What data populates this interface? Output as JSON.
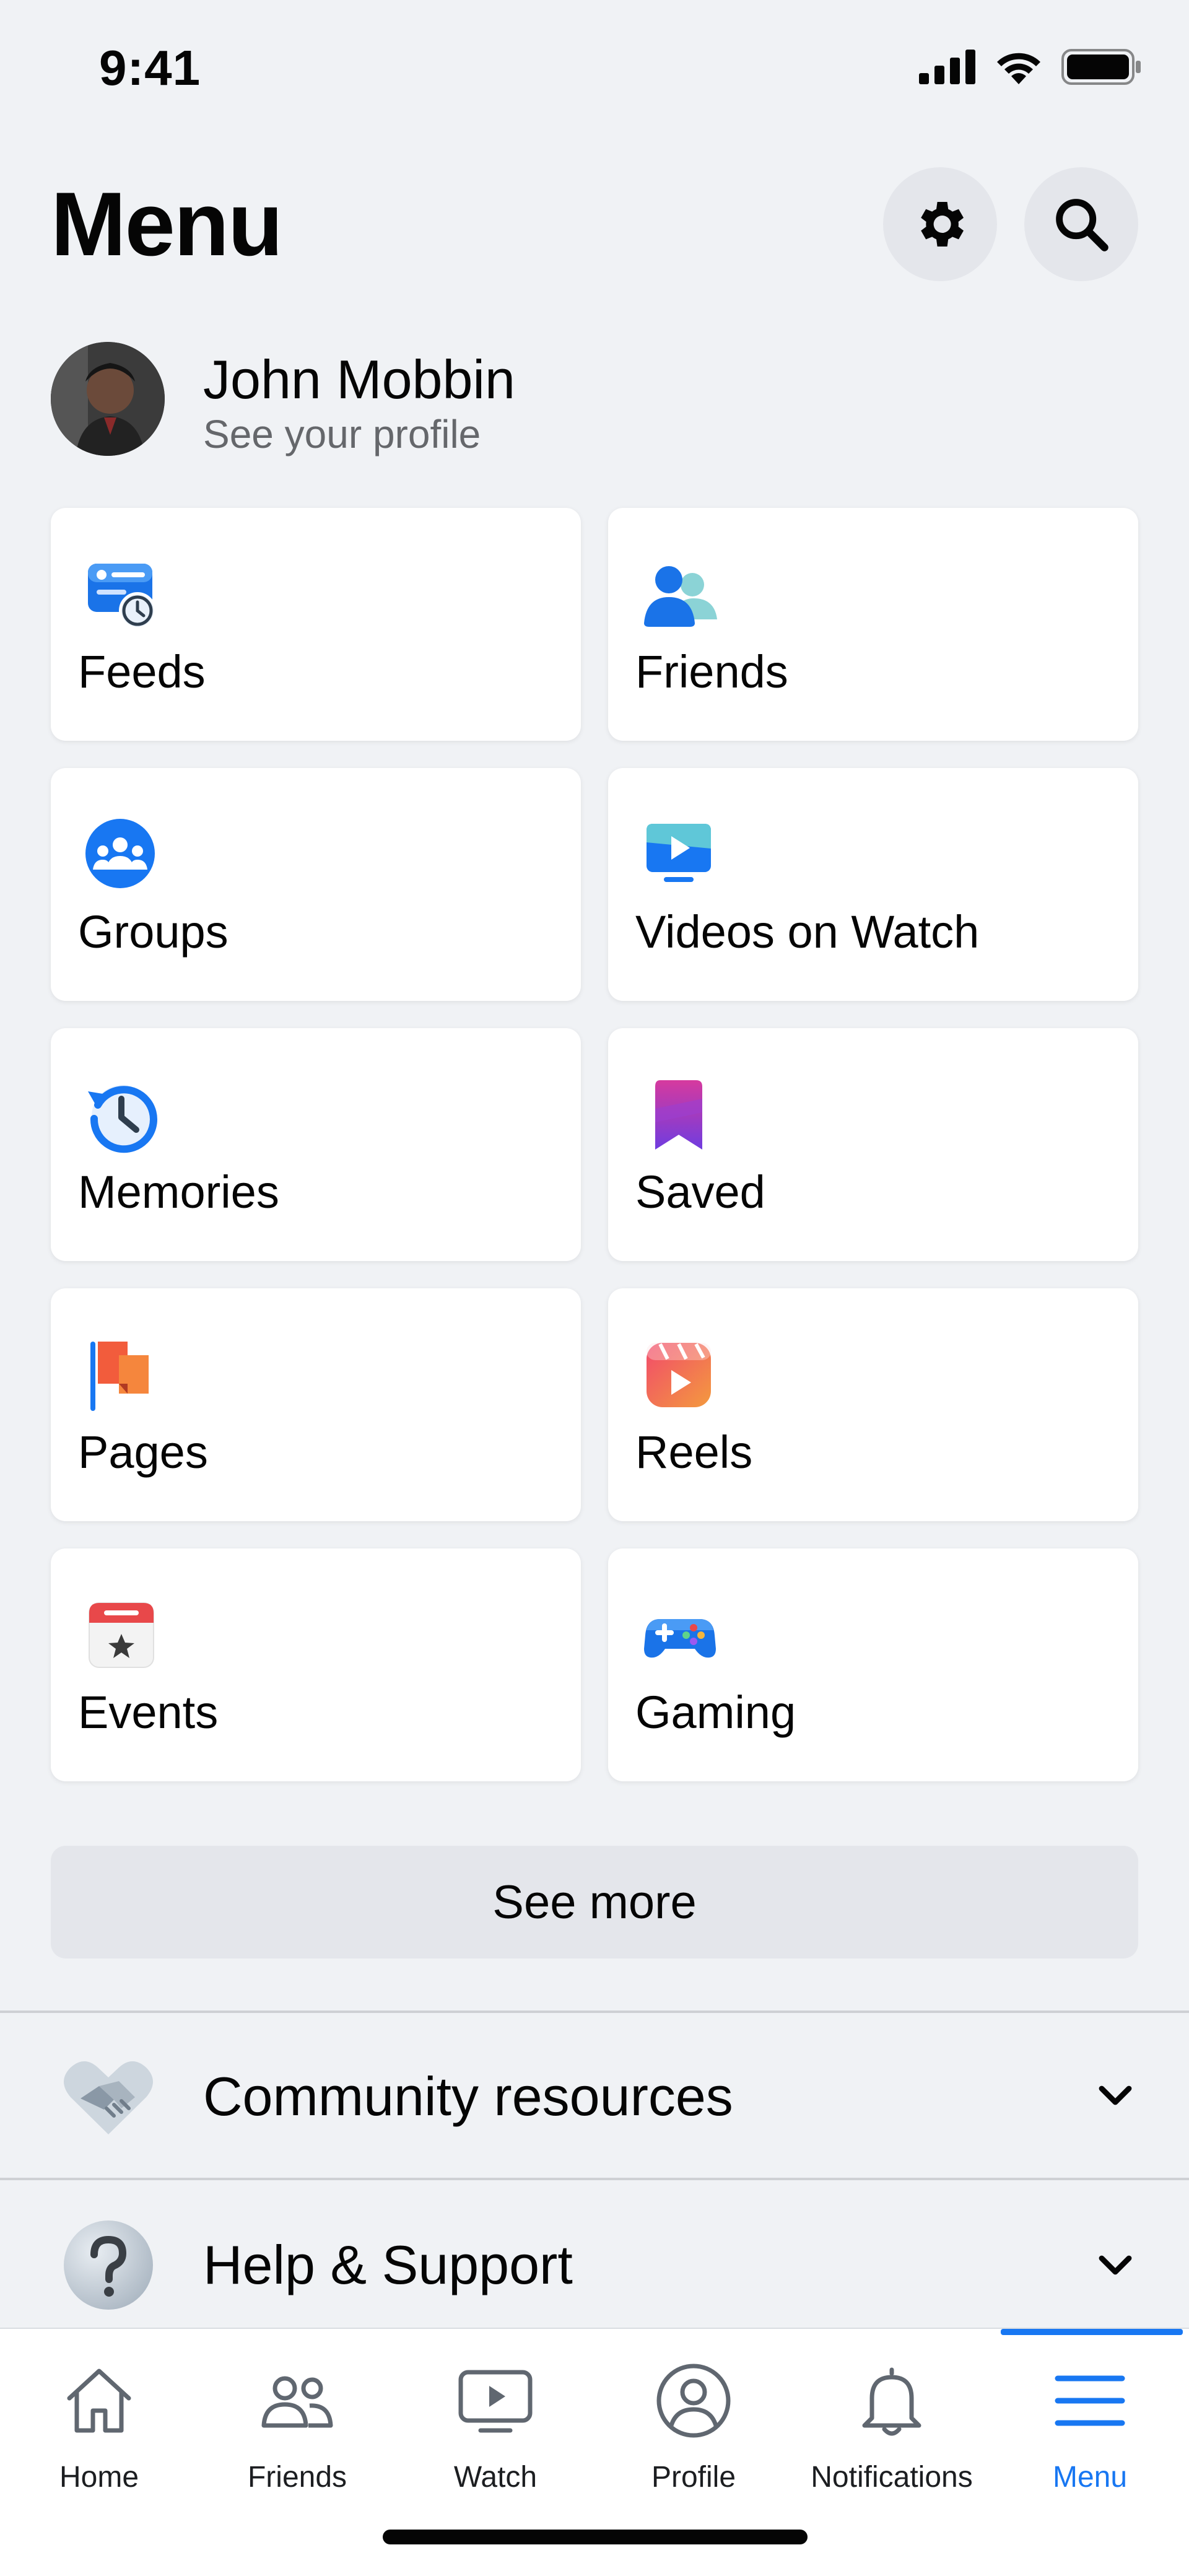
{
  "status_bar": {
    "time": "9:41"
  },
  "header": {
    "title": "Menu"
  },
  "profile": {
    "name": "John Mobbin",
    "subtitle": "See your profile"
  },
  "shortcuts": [
    {
      "label": "Feeds",
      "icon": "feeds-icon"
    },
    {
      "label": "Friends",
      "icon": "friends-icon"
    },
    {
      "label": "Groups",
      "icon": "groups-icon"
    },
    {
      "label": "Videos on Watch",
      "icon": "video-icon"
    },
    {
      "label": "Memories",
      "icon": "memories-icon"
    },
    {
      "label": "Saved",
      "icon": "bookmark-icon"
    },
    {
      "label": "Pages",
      "icon": "flag-icon"
    },
    {
      "label": "Reels",
      "icon": "reels-icon"
    },
    {
      "label": "Events",
      "icon": "calendar-icon"
    },
    {
      "label": "Gaming",
      "icon": "gamepad-icon"
    }
  ],
  "see_more": "See more",
  "sections": [
    {
      "label": "Community resources",
      "icon": "handshake-icon"
    },
    {
      "label": "Help & Support",
      "icon": "question-icon"
    }
  ],
  "tab_bar": {
    "tabs": [
      {
        "label": "Home",
        "icon": "home-icon"
      },
      {
        "label": "Friends",
        "icon": "friends-icon"
      },
      {
        "label": "Watch",
        "icon": "watch-icon"
      },
      {
        "label": "Profile",
        "icon": "profile-icon"
      },
      {
        "label": "Notifications",
        "icon": "bell-icon"
      },
      {
        "label": "Menu",
        "icon": "hamburger-icon"
      }
    ],
    "active": "Menu"
  },
  "colors": {
    "accent": "#1877f2",
    "background": "#f0f2f5",
    "card": "#ffffff"
  }
}
